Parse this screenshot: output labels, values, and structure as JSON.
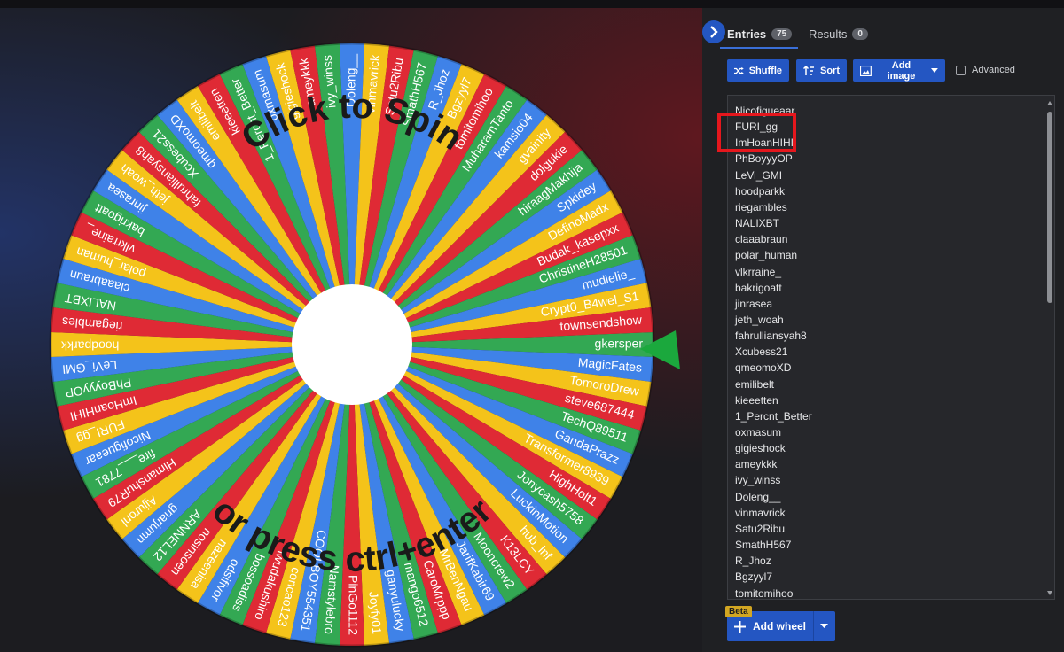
{
  "panel": {
    "tabs": [
      {
        "label": "Entries",
        "count": "75"
      },
      {
        "label": "Results",
        "count": "0"
      }
    ],
    "toolbar": {
      "shuffle_label": "Shuffle",
      "sort_label": "Sort",
      "add_image_label": "Add image",
      "advanced_label": "Advanced"
    },
    "entries": [
      "Nicofigueaar",
      "FURI_gg",
      "ImHoanHIHI",
      "PhBoyyyOP",
      "LeVi_GMI",
      "hoodparkk",
      "riegambles",
      "NALIXBT",
      "claaabraun",
      "polar_human",
      "vlkrraine_",
      "bakrigoatt",
      "jinrasea",
      "jeth_woah",
      "fahrulliansyah8",
      "Xcubess21",
      "qmeomoXD",
      "emilibelt",
      "kieeetten",
      "1_Percnt_Better",
      "oxmasum",
      "gigieshock",
      "ameykkk",
      "ivy_winss",
      "Doleng__",
      "vinmavrick",
      "Satu2Ribu",
      "SmathH567",
      "R_Jhoz",
      "Bgzyyl7",
      "tomitomihoo"
    ],
    "add_wheel": {
      "beta_label": "Beta",
      "label": "Add wheel"
    },
    "highlight_color": "#e5171d",
    "accent_color": "#2456c2"
  },
  "wheel": {
    "top_text": "Click to Spin",
    "bottom_text": "or press ctrl+enter",
    "segment_colors": [
      "#33a853",
      "#3f82e8",
      "#f4c31a",
      "#df2a35"
    ],
    "pointer_color": "#1ba83d",
    "segments": [
      "gkersper",
      "MagicFates",
      "TomoroDrew",
      "steve687444",
      "TechQ89511",
      "GandaPrazz",
      "Transformer8939",
      "HighHolt1",
      "Jonycash5758",
      "LuckinMotion",
      "hub_inf",
      "K13LCY",
      "Mooncrew2",
      "JarifKabir69",
      "MrBenNgau",
      "CaroMrppp",
      "mango6512",
      "ganyulucky",
      "Joyfy01",
      "PinGo1112",
      "Namstylebro",
      "COOLBOY554351",
      "concao123",
      "iwudakushiro",
      "bossoadiss",
      "odsifivor",
      "nazeenisa",
      "nosinsoen",
      "ARNNEL12",
      "gnarjumn",
      "Ajjuronl",
      "HimanshuR79",
      "fire___7781",
      "Nicofigueaar",
      "FURI_gg",
      "ImHoanHIHI",
      "PhBoyyyOP",
      "LeVi_GMI",
      "hoodparkk",
      "riegambles",
      "NALIXBT",
      "claaabraun",
      "polar_human",
      "vlkrraine_",
      "bakrigoatt",
      "jinrasea",
      "jeth_woah",
      "fahrulliansyah8",
      "Xcubess21",
      "qmeomoXD",
      "emilibelt",
      "kieeetten",
      "1_Percnt_Better",
      "oxmasum",
      "gigieshock",
      "ameykkk",
      "ivy_winss",
      "Doleng__",
      "vinmavrick",
      "Satu2Ribu",
      "SmathH567",
      "R_Jhoz",
      "Bgzyyl7",
      "tomitomihoo",
      "MuharamTanto",
      "kamsio04",
      "gvainity",
      "dolgukie",
      "hiraagMakhija",
      "Spkidey",
      "DefinoMadx",
      "Budak_kasepxx",
      "ChristineH28501",
      "mudielie_",
      "Crypt0_B4wel_S1",
      "townsendshow"
    ]
  }
}
